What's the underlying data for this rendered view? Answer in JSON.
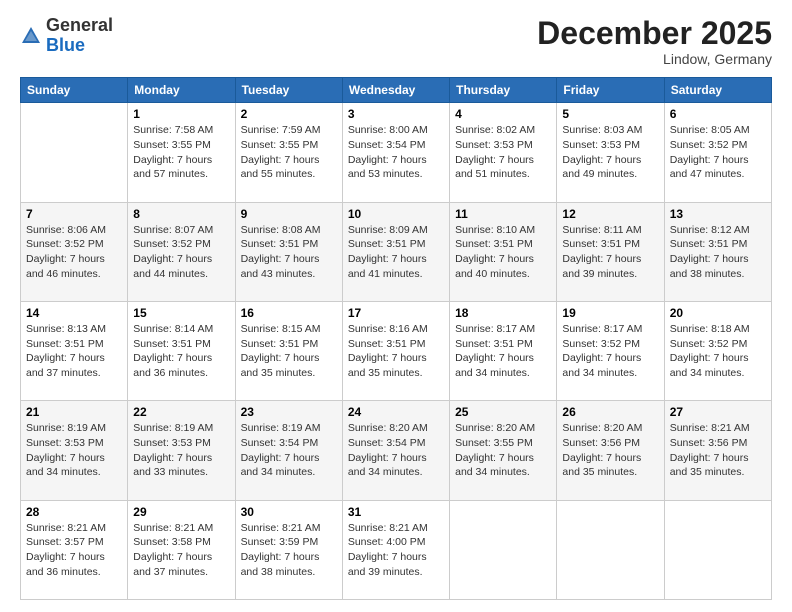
{
  "header": {
    "logo_general": "General",
    "logo_blue": "Blue",
    "month_title": "December 2025",
    "location": "Lindow, Germany"
  },
  "days_of_week": [
    "Sunday",
    "Monday",
    "Tuesday",
    "Wednesday",
    "Thursday",
    "Friday",
    "Saturday"
  ],
  "weeks": [
    [
      {
        "date": "",
        "info": ""
      },
      {
        "date": "1",
        "info": "Sunrise: 7:58 AM\nSunset: 3:55 PM\nDaylight: 7 hours\nand 57 minutes."
      },
      {
        "date": "2",
        "info": "Sunrise: 7:59 AM\nSunset: 3:55 PM\nDaylight: 7 hours\nand 55 minutes."
      },
      {
        "date": "3",
        "info": "Sunrise: 8:00 AM\nSunset: 3:54 PM\nDaylight: 7 hours\nand 53 minutes."
      },
      {
        "date": "4",
        "info": "Sunrise: 8:02 AM\nSunset: 3:53 PM\nDaylight: 7 hours\nand 51 minutes."
      },
      {
        "date": "5",
        "info": "Sunrise: 8:03 AM\nSunset: 3:53 PM\nDaylight: 7 hours\nand 49 minutes."
      },
      {
        "date": "6",
        "info": "Sunrise: 8:05 AM\nSunset: 3:52 PM\nDaylight: 7 hours\nand 47 minutes."
      }
    ],
    [
      {
        "date": "7",
        "info": "Sunrise: 8:06 AM\nSunset: 3:52 PM\nDaylight: 7 hours\nand 46 minutes."
      },
      {
        "date": "8",
        "info": "Sunrise: 8:07 AM\nSunset: 3:52 PM\nDaylight: 7 hours\nand 44 minutes."
      },
      {
        "date": "9",
        "info": "Sunrise: 8:08 AM\nSunset: 3:51 PM\nDaylight: 7 hours\nand 43 minutes."
      },
      {
        "date": "10",
        "info": "Sunrise: 8:09 AM\nSunset: 3:51 PM\nDaylight: 7 hours\nand 41 minutes."
      },
      {
        "date": "11",
        "info": "Sunrise: 8:10 AM\nSunset: 3:51 PM\nDaylight: 7 hours\nand 40 minutes."
      },
      {
        "date": "12",
        "info": "Sunrise: 8:11 AM\nSunset: 3:51 PM\nDaylight: 7 hours\nand 39 minutes."
      },
      {
        "date": "13",
        "info": "Sunrise: 8:12 AM\nSunset: 3:51 PM\nDaylight: 7 hours\nand 38 minutes."
      }
    ],
    [
      {
        "date": "14",
        "info": "Sunrise: 8:13 AM\nSunset: 3:51 PM\nDaylight: 7 hours\nand 37 minutes."
      },
      {
        "date": "15",
        "info": "Sunrise: 8:14 AM\nSunset: 3:51 PM\nDaylight: 7 hours\nand 36 minutes."
      },
      {
        "date": "16",
        "info": "Sunrise: 8:15 AM\nSunset: 3:51 PM\nDaylight: 7 hours\nand 35 minutes."
      },
      {
        "date": "17",
        "info": "Sunrise: 8:16 AM\nSunset: 3:51 PM\nDaylight: 7 hours\nand 35 minutes."
      },
      {
        "date": "18",
        "info": "Sunrise: 8:17 AM\nSunset: 3:51 PM\nDaylight: 7 hours\nand 34 minutes."
      },
      {
        "date": "19",
        "info": "Sunrise: 8:17 AM\nSunset: 3:52 PM\nDaylight: 7 hours\nand 34 minutes."
      },
      {
        "date": "20",
        "info": "Sunrise: 8:18 AM\nSunset: 3:52 PM\nDaylight: 7 hours\nand 34 minutes."
      }
    ],
    [
      {
        "date": "21",
        "info": "Sunrise: 8:19 AM\nSunset: 3:53 PM\nDaylight: 7 hours\nand 34 minutes."
      },
      {
        "date": "22",
        "info": "Sunrise: 8:19 AM\nSunset: 3:53 PM\nDaylight: 7 hours\nand 33 minutes."
      },
      {
        "date": "23",
        "info": "Sunrise: 8:19 AM\nSunset: 3:54 PM\nDaylight: 7 hours\nand 34 minutes."
      },
      {
        "date": "24",
        "info": "Sunrise: 8:20 AM\nSunset: 3:54 PM\nDaylight: 7 hours\nand 34 minutes."
      },
      {
        "date": "25",
        "info": "Sunrise: 8:20 AM\nSunset: 3:55 PM\nDaylight: 7 hours\nand 34 minutes."
      },
      {
        "date": "26",
        "info": "Sunrise: 8:20 AM\nSunset: 3:56 PM\nDaylight: 7 hours\nand 35 minutes."
      },
      {
        "date": "27",
        "info": "Sunrise: 8:21 AM\nSunset: 3:56 PM\nDaylight: 7 hours\nand 35 minutes."
      }
    ],
    [
      {
        "date": "28",
        "info": "Sunrise: 8:21 AM\nSunset: 3:57 PM\nDaylight: 7 hours\nand 36 minutes."
      },
      {
        "date": "29",
        "info": "Sunrise: 8:21 AM\nSunset: 3:58 PM\nDaylight: 7 hours\nand 37 minutes."
      },
      {
        "date": "30",
        "info": "Sunrise: 8:21 AM\nSunset: 3:59 PM\nDaylight: 7 hours\nand 38 minutes."
      },
      {
        "date": "31",
        "info": "Sunrise: 8:21 AM\nSunset: 4:00 PM\nDaylight: 7 hours\nand 39 minutes."
      },
      {
        "date": "",
        "info": ""
      },
      {
        "date": "",
        "info": ""
      },
      {
        "date": "",
        "info": ""
      }
    ]
  ]
}
